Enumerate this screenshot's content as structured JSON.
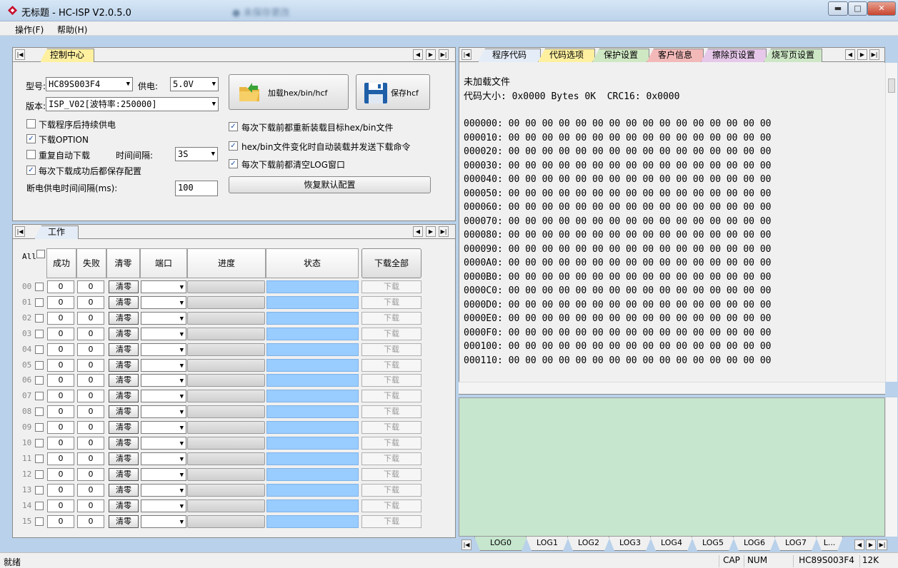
{
  "window": {
    "title": "无标题 - HC-ISP V2.0.5.0",
    "blurred_text": "● 未保存更改"
  },
  "menu": [
    "操作(F)",
    "帮助(H)"
  ],
  "control": {
    "tab_label": "控制中心",
    "model_label": "型号:",
    "model_value": "HC89S003F4",
    "power_label": "供电:",
    "power_value": "5.0V",
    "version_label": "版本:",
    "version_value": "ISP_V02[波特率:250000]",
    "load_button": "加载hex/bin/hcf",
    "save_button": "保存hcf",
    "options_left": [
      {
        "label": "下载程序后持续供电",
        "checked": false
      },
      {
        "label": "下载OPTION",
        "checked": true
      },
      {
        "label": "重复自动下载",
        "checked": false
      },
      {
        "label": "每次下载成功后都保存配置",
        "checked": true
      }
    ],
    "interval_label": "时间间隔:",
    "interval_value": "3S",
    "power_off_label": "断电供电时间间隔(ms):",
    "power_off_value": "100",
    "options_right": [
      {
        "label": "每次下载前都重新装载目标hex/bin文件",
        "checked": true
      },
      {
        "label": "hex/bin文件变化时自动装载并发送下载命令",
        "checked": true
      },
      {
        "label": "每次下载前都清空LOG窗口",
        "checked": true
      }
    ],
    "restore_button": "恢复默认配置"
  },
  "work": {
    "tab_label": "工作",
    "all_label": "All",
    "headers": {
      "success": "成功",
      "fail": "失败",
      "clear": "清零",
      "port": "端口",
      "progress": "进度",
      "status": "状态",
      "download_all": "下载全部"
    },
    "rows": [
      {
        "id": "00",
        "success": "0",
        "fail": "0",
        "clear": "清零",
        "download": "下载"
      },
      {
        "id": "01",
        "success": "0",
        "fail": "0",
        "clear": "清零",
        "download": "下载"
      },
      {
        "id": "02",
        "success": "0",
        "fail": "0",
        "clear": "清零",
        "download": "下载"
      },
      {
        "id": "03",
        "success": "0",
        "fail": "0",
        "clear": "清零",
        "download": "下载"
      },
      {
        "id": "04",
        "success": "0",
        "fail": "0",
        "clear": "清零",
        "download": "下载"
      },
      {
        "id": "05",
        "success": "0",
        "fail": "0",
        "clear": "清零",
        "download": "下载"
      },
      {
        "id": "06",
        "success": "0",
        "fail": "0",
        "clear": "清零",
        "download": "下载"
      },
      {
        "id": "07",
        "success": "0",
        "fail": "0",
        "clear": "清零",
        "download": "下载"
      },
      {
        "id": "08",
        "success": "0",
        "fail": "0",
        "clear": "清零",
        "download": "下载"
      },
      {
        "id": "09",
        "success": "0",
        "fail": "0",
        "clear": "清零",
        "download": "下载"
      },
      {
        "id": "10",
        "success": "0",
        "fail": "0",
        "clear": "清零",
        "download": "下载"
      },
      {
        "id": "11",
        "success": "0",
        "fail": "0",
        "clear": "清零",
        "download": "下载"
      },
      {
        "id": "12",
        "success": "0",
        "fail": "0",
        "clear": "清零",
        "download": "下载"
      },
      {
        "id": "13",
        "success": "0",
        "fail": "0",
        "clear": "清零",
        "download": "下载"
      },
      {
        "id": "14",
        "success": "0",
        "fail": "0",
        "clear": "清零",
        "download": "下载"
      },
      {
        "id": "15",
        "success": "0",
        "fail": "0",
        "clear": "清零",
        "download": "下载"
      }
    ]
  },
  "code": {
    "tabs": [
      {
        "label": "程序代码",
        "color": "#e4ecf7"
      },
      {
        "label": "代码选项",
        "color": "#fff0a0"
      },
      {
        "label": "保护设置",
        "color": "#cfe8c4"
      },
      {
        "label": "客户信息",
        "color": "#f3b9b9"
      },
      {
        "label": "擦除页设置",
        "color": "#e6c8ea"
      },
      {
        "label": "烧写页设置",
        "color": "#cde7c6"
      }
    ],
    "status_line": "未加载文件",
    "size_line": "代码大小: 0x0000 Bytes 0K  CRC16: 0x0000",
    "hex_lines": [
      "000000: 00 00 00 00 00 00 00 00 00 00 00 00 00 00 00 00",
      "000010: 00 00 00 00 00 00 00 00 00 00 00 00 00 00 00 00",
      "000020: 00 00 00 00 00 00 00 00 00 00 00 00 00 00 00 00",
      "000030: 00 00 00 00 00 00 00 00 00 00 00 00 00 00 00 00",
      "000040: 00 00 00 00 00 00 00 00 00 00 00 00 00 00 00 00",
      "000050: 00 00 00 00 00 00 00 00 00 00 00 00 00 00 00 00",
      "000060: 00 00 00 00 00 00 00 00 00 00 00 00 00 00 00 00",
      "000070: 00 00 00 00 00 00 00 00 00 00 00 00 00 00 00 00",
      "000080: 00 00 00 00 00 00 00 00 00 00 00 00 00 00 00 00",
      "000090: 00 00 00 00 00 00 00 00 00 00 00 00 00 00 00 00",
      "0000A0: 00 00 00 00 00 00 00 00 00 00 00 00 00 00 00 00",
      "0000B0: 00 00 00 00 00 00 00 00 00 00 00 00 00 00 00 00",
      "0000C0: 00 00 00 00 00 00 00 00 00 00 00 00 00 00 00 00",
      "0000D0: 00 00 00 00 00 00 00 00 00 00 00 00 00 00 00 00",
      "0000E0: 00 00 00 00 00 00 00 00 00 00 00 00 00 00 00 00",
      "0000F0: 00 00 00 00 00 00 00 00 00 00 00 00 00 00 00 00",
      "000100: 00 00 00 00 00 00 00 00 00 00 00 00 00 00 00 00",
      "000110: 00 00 00 00 00 00 00 00 00 00 00 00 00 00 00 00"
    ]
  },
  "log": {
    "tabs": [
      "LOG0",
      "LOG1",
      "LOG2",
      "LOG3",
      "LOG4",
      "LOG5",
      "LOG6",
      "LOG7",
      "L..."
    ],
    "active": "LOG0",
    "bg_color": "#c6e6ce"
  },
  "statusbar": {
    "ready": "就绪",
    "cap": "CAP",
    "num": "NUM",
    "model": "HC89S003F4",
    "size": "12K"
  }
}
